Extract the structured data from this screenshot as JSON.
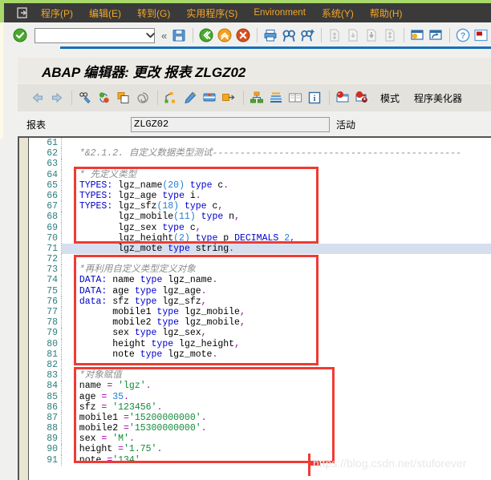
{
  "window": {
    "accent_green": "#a8d96a",
    "menubar_bg": "#3a3a3a",
    "menu_text_color": "#f5a623"
  },
  "menubar": {
    "doc_icon": "document-arrow-icon",
    "items": [
      {
        "label": "程序(P)",
        "name": "menu-program"
      },
      {
        "label": "编辑(E)",
        "name": "menu-edit"
      },
      {
        "label": "转到(G)",
        "name": "menu-goto"
      },
      {
        "label": "实用程序(S)",
        "name": "menu-utilities"
      },
      {
        "label": "Environment",
        "name": "menu-environment"
      },
      {
        "label": "系统(Y)",
        "name": "menu-system"
      },
      {
        "label": "帮助(H)",
        "name": "menu-help"
      }
    ]
  },
  "toolbar_main": {
    "enter_icon": "green-check-icon",
    "command_field": {
      "value": "",
      "placeholder": ""
    },
    "dropdown_icon": "chevron-down-icon",
    "collapse_icon": "double-chevron-left-icon",
    "icons": [
      "save-icon",
      "back-green-icon",
      "exit-orange-icon",
      "cancel-red-icon",
      "print-icon",
      "find-icon",
      "find-next-icon",
      "first-page-icon",
      "previous-page-icon",
      "next-page-icon",
      "last-page-icon",
      "create-session-icon",
      "create-shortcut-icon",
      "help-icon",
      "customize-local-layout-icon"
    ]
  },
  "title": {
    "text": "ABAP 编辑器: 更改 报表 ZLGZ02"
  },
  "toolbar_editor": {
    "icons": [
      "back-arrow-icon",
      "forward-arrow-icon",
      "display-change-icon",
      "check-syntax-icon",
      "activate-icon",
      "pattern-icon",
      "pretty-printer-icon",
      "highlight-icon",
      "replace-icon",
      "insert-statement-icon",
      "where-used-icon",
      "navigation-stack-icon",
      "documentation-icon",
      "information-icon",
      "debugger-icon",
      "breakpoint-icon"
    ],
    "buttons": [
      {
        "label": "模式",
        "name": "mode-button"
      },
      {
        "label": "程序美化器",
        "name": "pretty-printer-button"
      }
    ]
  },
  "report_row": {
    "label": "报表",
    "value": "ZLGZ02",
    "status": "活动"
  },
  "editor": {
    "first_line_number": 61,
    "selected_line": 71,
    "watermark": "https://blog.csdn.net/stuforever",
    "lines": [
      {
        "no": 61,
        "tokens": []
      },
      {
        "no": 62,
        "tokens": [
          {
            "t": "  ",
            "c": ""
          },
          {
            "t": "*&2.1.2. 自定义数据类型测试---------------------------------------------",
            "c": "cm"
          }
        ]
      },
      {
        "no": 63,
        "tokens": []
      },
      {
        "no": 64,
        "tokens": [
          {
            "t": "  ",
            "c": ""
          },
          {
            "t": "* 先定义类型",
            "c": "cm"
          }
        ]
      },
      {
        "no": 65,
        "tokens": [
          {
            "t": "  ",
            "c": ""
          },
          {
            "t": "TYPES:",
            "c": "k"
          },
          {
            "t": " lgz_name",
            "c": ""
          },
          {
            "t": "(20)",
            "c": "n"
          },
          {
            "t": " ",
            "c": ""
          },
          {
            "t": "type",
            "c": "k"
          },
          {
            "t": " c",
            "c": ""
          },
          {
            "t": ".",
            "c": "p"
          }
        ]
      },
      {
        "no": 66,
        "tokens": [
          {
            "t": "  ",
            "c": ""
          },
          {
            "t": "TYPES:",
            "c": "k"
          },
          {
            "t": " lgz_age ",
            "c": ""
          },
          {
            "t": "type",
            "c": "k"
          },
          {
            "t": " i",
            "c": ""
          },
          {
            "t": ".",
            "c": "p"
          }
        ]
      },
      {
        "no": 67,
        "tokens": [
          {
            "t": "  ",
            "c": ""
          },
          {
            "t": "TYPES:",
            "c": "k"
          },
          {
            "t": " lgz_sfz",
            "c": ""
          },
          {
            "t": "(18)",
            "c": "n"
          },
          {
            "t": " ",
            "c": ""
          },
          {
            "t": "type",
            "c": "k"
          },
          {
            "t": " c",
            "c": ""
          },
          {
            "t": ",",
            "c": "p"
          }
        ]
      },
      {
        "no": 68,
        "tokens": [
          {
            "t": "         lgz_mobile",
            "c": ""
          },
          {
            "t": "(11)",
            "c": "n"
          },
          {
            "t": " ",
            "c": ""
          },
          {
            "t": "type",
            "c": "k"
          },
          {
            "t": " n",
            "c": ""
          },
          {
            "t": ",",
            "c": "p"
          }
        ]
      },
      {
        "no": 69,
        "tokens": [
          {
            "t": "         lgz_sex ",
            "c": ""
          },
          {
            "t": "type",
            "c": "k"
          },
          {
            "t": " c",
            "c": ""
          },
          {
            "t": ",",
            "c": "p"
          }
        ]
      },
      {
        "no": 70,
        "tokens": [
          {
            "t": "         lgz_height",
            "c": ""
          },
          {
            "t": "(2)",
            "c": "n"
          },
          {
            "t": " ",
            "c": ""
          },
          {
            "t": "type",
            "c": "k"
          },
          {
            "t": " p ",
            "c": ""
          },
          {
            "t": "DECIMALS",
            "c": "k"
          },
          {
            "t": " ",
            "c": ""
          },
          {
            "t": "2",
            "c": "n"
          },
          {
            "t": ",",
            "c": "p"
          }
        ]
      },
      {
        "no": 71,
        "sel": true,
        "tokens": [
          {
            "t": "         lgz_mote ",
            "c": ""
          },
          {
            "t": "type",
            "c": "k"
          },
          {
            "t": " string",
            "c": ""
          },
          {
            "t": ".",
            "c": "p"
          }
        ]
      },
      {
        "no": 72,
        "tokens": []
      },
      {
        "no": 73,
        "tokens": [
          {
            "t": "  ",
            "c": ""
          },
          {
            "t": "*再利用自定义类型定义对象",
            "c": "cm"
          }
        ]
      },
      {
        "no": 74,
        "tokens": [
          {
            "t": "  ",
            "c": ""
          },
          {
            "t": "DATA:",
            "c": "k"
          },
          {
            "t": " name ",
            "c": ""
          },
          {
            "t": "type",
            "c": "k"
          },
          {
            "t": " lgz_name",
            "c": ""
          },
          {
            "t": ".",
            "c": "p"
          }
        ]
      },
      {
        "no": 75,
        "tokens": [
          {
            "t": "  ",
            "c": ""
          },
          {
            "t": "DATA:",
            "c": "k"
          },
          {
            "t": " age ",
            "c": ""
          },
          {
            "t": "type",
            "c": "k"
          },
          {
            "t": " lgz_age",
            "c": ""
          },
          {
            "t": ".",
            "c": "p"
          }
        ]
      },
      {
        "no": 76,
        "tokens": [
          {
            "t": "  ",
            "c": ""
          },
          {
            "t": "data:",
            "c": "k"
          },
          {
            "t": " sfz ",
            "c": ""
          },
          {
            "t": "type",
            "c": "k"
          },
          {
            "t": " lgz_sfz",
            "c": ""
          },
          {
            "t": ",",
            "c": "p"
          }
        ]
      },
      {
        "no": 77,
        "tokens": [
          {
            "t": "        mobile1 ",
            "c": ""
          },
          {
            "t": "type",
            "c": "k"
          },
          {
            "t": " lgz_mobile",
            "c": ""
          },
          {
            "t": ",",
            "c": "p"
          }
        ]
      },
      {
        "no": 78,
        "tokens": [
          {
            "t": "        mobile2 ",
            "c": ""
          },
          {
            "t": "type",
            "c": "k"
          },
          {
            "t": " lgz_mobile",
            "c": ""
          },
          {
            "t": ",",
            "c": "p"
          }
        ]
      },
      {
        "no": 79,
        "tokens": [
          {
            "t": "        sex ",
            "c": ""
          },
          {
            "t": "type",
            "c": "k"
          },
          {
            "t": " lgz_sex",
            "c": ""
          },
          {
            "t": ",",
            "c": "p"
          }
        ]
      },
      {
        "no": 80,
        "tokens": [
          {
            "t": "        height ",
            "c": ""
          },
          {
            "t": "type",
            "c": "k"
          },
          {
            "t": " lgz_height",
            "c": ""
          },
          {
            "t": ",",
            "c": "p"
          }
        ]
      },
      {
        "no": 81,
        "tokens": [
          {
            "t": "        note ",
            "c": ""
          },
          {
            "t": "type",
            "c": "k"
          },
          {
            "t": " lgz_mote",
            "c": ""
          },
          {
            "t": ".",
            "c": "p"
          }
        ]
      },
      {
        "no": 82,
        "tokens": []
      },
      {
        "no": 83,
        "tokens": [
          {
            "t": "  ",
            "c": ""
          },
          {
            "t": "*对象赋值",
            "c": "cm"
          }
        ]
      },
      {
        "no": 84,
        "tokens": [
          {
            "t": "  name ",
            "c": ""
          },
          {
            "t": "=",
            "c": "p"
          },
          {
            "t": " ",
            "c": ""
          },
          {
            "t": "'lgz'",
            "c": "s"
          },
          {
            "t": ".",
            "c": "p"
          }
        ]
      },
      {
        "no": 85,
        "tokens": [
          {
            "t": "  age ",
            "c": ""
          },
          {
            "t": "=",
            "c": "p"
          },
          {
            "t": " ",
            "c": ""
          },
          {
            "t": "35",
            "c": "n"
          },
          {
            "t": ".",
            "c": "p"
          }
        ]
      },
      {
        "no": 86,
        "tokens": [
          {
            "t": "  sfz ",
            "c": ""
          },
          {
            "t": "=",
            "c": "p"
          },
          {
            "t": " ",
            "c": ""
          },
          {
            "t": "'123456'",
            "c": "s"
          },
          {
            "t": ".",
            "c": "p"
          }
        ]
      },
      {
        "no": 87,
        "tokens": [
          {
            "t": "  mobile1 ",
            "c": ""
          },
          {
            "t": "=",
            "c": "p"
          },
          {
            "t": "'15200000000'",
            "c": "s"
          },
          {
            "t": ".",
            "c": "p"
          }
        ]
      },
      {
        "no": 88,
        "tokens": [
          {
            "t": "  mobile2 ",
            "c": ""
          },
          {
            "t": "=",
            "c": "p"
          },
          {
            "t": "'15300000000'",
            "c": "s"
          },
          {
            "t": ".",
            "c": "p"
          }
        ]
      },
      {
        "no": 89,
        "tokens": [
          {
            "t": "  sex ",
            "c": ""
          },
          {
            "t": "=",
            "c": "p"
          },
          {
            "t": " ",
            "c": ""
          },
          {
            "t": "'M'",
            "c": "s"
          },
          {
            "t": ".",
            "c": "p"
          }
        ]
      },
      {
        "no": 90,
        "tokens": [
          {
            "t": "  height ",
            "c": ""
          },
          {
            "t": "=",
            "c": "p"
          },
          {
            "t": "'1.75'",
            "c": "s"
          },
          {
            "t": ".",
            "c": "p"
          }
        ]
      },
      {
        "no": 91,
        "tokens": [
          {
            "t": "  note ",
            "c": ""
          },
          {
            "t": "=",
            "c": "p"
          },
          {
            "t": "'134'",
            "c": "s"
          },
          {
            "t": ".",
            "c": "p"
          }
        ]
      }
    ],
    "annotations": [
      {
        "name": "annotation-box-types",
        "color": "#ef3b33"
      },
      {
        "name": "annotation-box-data",
        "color": "#ef3b33"
      },
      {
        "name": "annotation-box-assignment",
        "color": "#ef3b33"
      }
    ]
  }
}
